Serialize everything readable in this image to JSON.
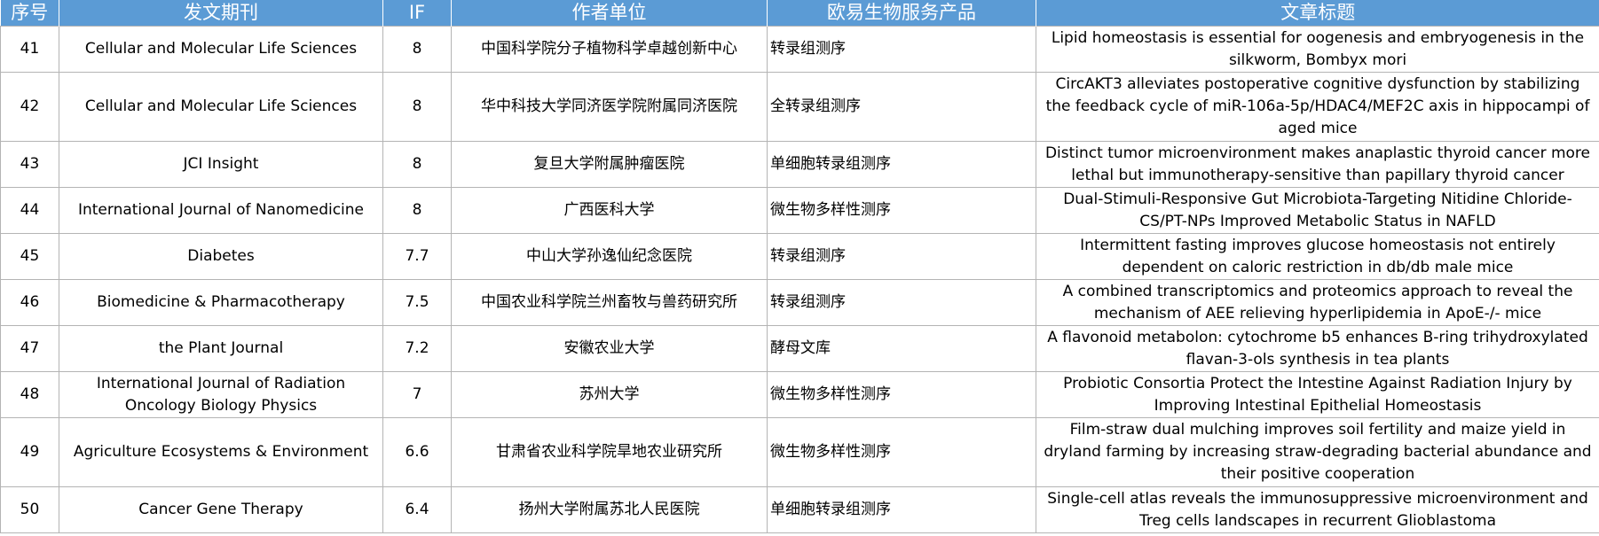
{
  "columns": [
    "序号",
    "发文期刊",
    "IF",
    "作者单位",
    "欧易生物服务产品",
    "文章标题"
  ],
  "rows": [
    {
      "no": "41",
      "journal": "Cellular and Molecular Life Sciences",
      "if": "8",
      "unit": "中国科学院分子植物科学卓越创新中心",
      "product": "转录组测序",
      "title": "Lipid homeostasis is essential for oogenesis and embryogenesis in the silkworm, Bombyx mori"
    },
    {
      "no": "42",
      "journal": "Cellular and Molecular Life Sciences",
      "if": "8",
      "unit": "华中科技大学同济医学院附属同济医院",
      "product": "全转录组测序",
      "title": "CircAKT3 alleviates postoperative cognitive dysfunction by stabilizing the feedback cycle of miR-106a-5p/HDAC4/MEF2C axis in hippocampi of aged mice"
    },
    {
      "no": "43",
      "journal": "JCI Insight",
      "if": "8",
      "unit": "复旦大学附属肿瘤医院",
      "product": "单细胞转录组测序",
      "title": "Distinct tumor microenvironment makes anaplastic thyroid cancer more lethal but immunotherapy-sensitive than papillary thyroid cancer"
    },
    {
      "no": "44",
      "journal": "International Journal of Nanomedicine",
      "if": "8",
      "unit": "广西医科大学",
      "product": "微生物多样性测序",
      "title": "Dual-Stimuli-Responsive Gut Microbiota-Targeting Nitidine Chloride-CS/PT-NPs Improved Metabolic Status in NAFLD"
    },
    {
      "no": "45",
      "journal": "Diabetes",
      "if": "7.7",
      "unit": "中山大学孙逸仙纪念医院",
      "product": "转录组测序",
      "title": "Intermittent fasting improves glucose homeostasis not entirely dependent on caloric restriction in db/db male mice"
    },
    {
      "no": "46",
      "journal": "Biomedicine & Pharmacotherapy",
      "if": "7.5",
      "unit": "中国农业科学院兰州畜牧与兽药研究所",
      "product": "转录组测序",
      "title": "A combined transcriptomics and proteomics approach to reveal the mechanism of AEE relieving hyperlipidemia in ApoE-/- mice"
    },
    {
      "no": "47",
      "journal": "the Plant Journal",
      "if": "7.2",
      "unit": "安徽农业大学",
      "product": "酵母文库",
      "title": "A flavonoid metabolon: cytochrome b5 enhances B-ring trihydroxylated flavan-3-ols synthesis in tea plants"
    },
    {
      "no": "48",
      "journal": "International Journal of Radiation Oncology Biology Physics",
      "if": "7",
      "unit": "苏州大学",
      "product": "微生物多样性测序",
      "title": "Probiotic Consortia Protect the Intestine Against Radiation Injury by Improving Intestinal Epithelial Homeostasis"
    },
    {
      "no": "49",
      "journal": "Agriculture Ecosystems & Environment",
      "if": "6.6",
      "unit": "甘肃省农业科学院旱地农业研究所",
      "product": "微生物多样性测序",
      "title": "Film-straw dual mulching improves soil fertility and maize yield in dryland farming by increasing straw-degrading bacterial abundance and their positive cooperation"
    },
    {
      "no": "50",
      "journal": "Cancer Gene Therapy",
      "if": "6.4",
      "unit": "扬州大学附属苏北人民医院",
      "product": "单细胞转录组测序",
      "title": "Single-cell atlas reveals the immunosuppressive microenvironment and Treg cells landscapes in recurrent Glioblastoma"
    }
  ],
  "colors": {
    "header_bg": "#5b9bd5",
    "header_text": "#ffffff",
    "border": "#b4b4b4"
  }
}
